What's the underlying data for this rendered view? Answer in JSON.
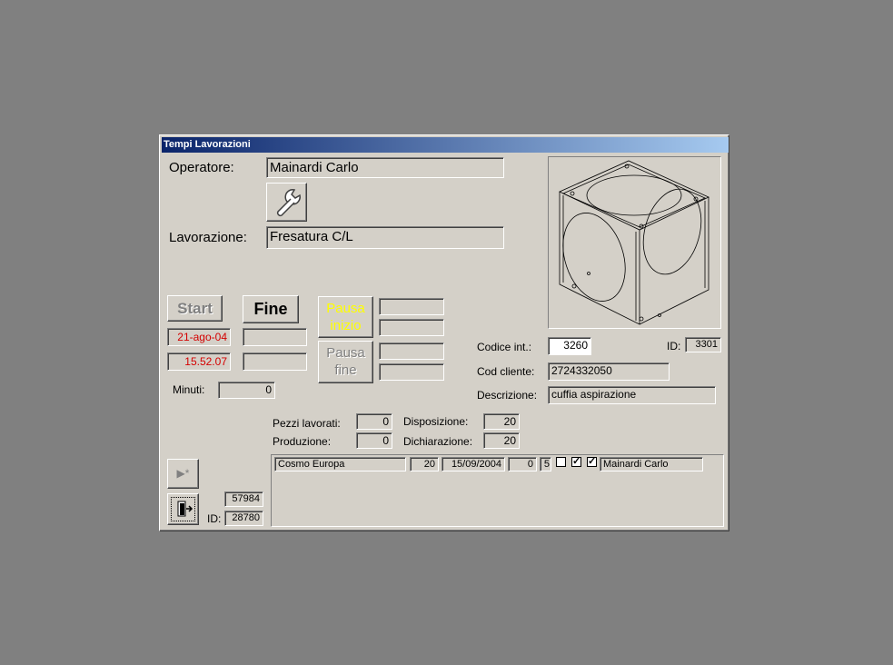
{
  "window": {
    "title": "Tempi Lavorazioni"
  },
  "operatore": {
    "label": "Operatore:",
    "value": "Mainardi Carlo"
  },
  "lavorazione": {
    "label": "Lavorazione:",
    "value": "Fresatura C/L"
  },
  "buttons": {
    "start": "Start",
    "fine": "Fine",
    "pausa_inizio": [
      "Pausa",
      "inizio"
    ],
    "pausa_fine": [
      "Pausa",
      "fine"
    ]
  },
  "start_date": "21-ago-04",
  "start_time": "15.52.07",
  "minuti": {
    "label": "Minuti:",
    "value": "0"
  },
  "codice_int": {
    "label": "Codice  int.:",
    "value": "3260"
  },
  "id_top": {
    "label": "ID:",
    "value": "3301"
  },
  "cod_cliente": {
    "label": "Cod cliente:",
    "value": "2724332050"
  },
  "descrizione": {
    "label": "Descrizione:",
    "value": "cuffia aspirazione"
  },
  "pezzi_lavorati": {
    "label": "Pezzi lavorati:",
    "value": "0"
  },
  "produzione": {
    "label": "Produzione:",
    "value": "0"
  },
  "disposizione": {
    "label": "Disposizione:",
    "value": "20"
  },
  "dichiarazione": {
    "label": "Dichiarazione:",
    "value": "20"
  },
  "record": {
    "num": "57984",
    "id_label": "ID:",
    "id": "28780"
  },
  "subform_row": {
    "cliente": "Cosmo Europa",
    "qty": "20",
    "date": "15/09/2004",
    "val1": "0",
    "val2": "5",
    "check1": false,
    "check2": true,
    "check3": true,
    "operatore": "Mainardi Carlo"
  },
  "icons": {
    "wrench": "wrench-icon",
    "new_record": "new-record-icon",
    "exit": "exit-door-icon"
  },
  "colors": {
    "title_start": "#0a246a",
    "title_end": "#a6caf0",
    "red_text": "#d40000",
    "yellow_text": "#ffff00",
    "gray_text": "#808080"
  }
}
